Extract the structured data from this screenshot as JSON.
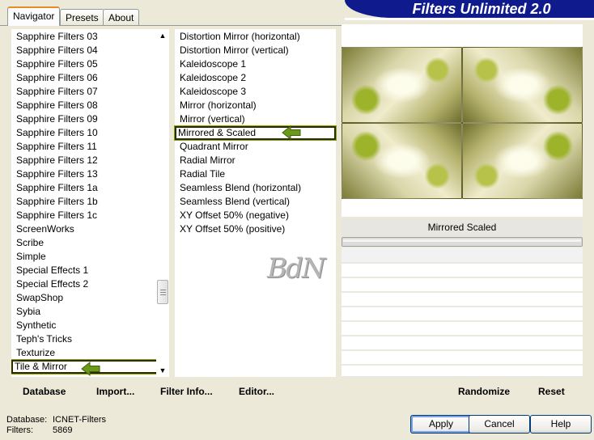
{
  "tabs": [
    "Navigator",
    "Presets",
    "About"
  ],
  "app_title": "Filters Unlimited 2.0",
  "categories": [
    "Sapphire Filters 03",
    "Sapphire Filters 04",
    "Sapphire Filters 05",
    "Sapphire Filters 06",
    "Sapphire Filters 07",
    "Sapphire Filters 08",
    "Sapphire Filters 09",
    "Sapphire Filters 10",
    "Sapphire Filters 11",
    "Sapphire Filters 12",
    "Sapphire Filters 13",
    "Sapphire Filters 1a",
    "Sapphire Filters 1b",
    "Sapphire Filters 1c",
    "ScreenWorks",
    "Scribe",
    "Simple",
    "Special Effects 1",
    "Special Effects 2",
    "SwapShop",
    "Sybia",
    "Synthetic",
    "Teph's Tricks",
    "Texturize",
    "Tile & Mirror"
  ],
  "selected_category": "Tile & Mirror",
  "filters": [
    "Distortion Mirror (horizontal)",
    "Distortion Mirror (vertical)",
    "Kaleidoscope 1",
    "Kaleidoscope 2",
    "Kaleidoscope 3",
    "Mirror (horizontal)",
    "Mirror (vertical)",
    "Mirrored & Scaled",
    "Quadrant Mirror",
    "Radial Mirror",
    "Radial Tile",
    "Seamless Blend (horizontal)",
    "Seamless Blend (vertical)",
    "XY Offset 50% (negative)",
    "XY Offset 50% (positive)"
  ],
  "selected_filter": "Mirrored & Scaled",
  "watermark": "BdN",
  "preview": {
    "filter_title": "Mirrored  Scaled"
  },
  "toolbar_left": {
    "database": "Database",
    "import": "Import...",
    "filter_info": "Filter Info...",
    "editor": "Editor..."
  },
  "toolbar_right": {
    "randomize": "Randomize",
    "reset": "Reset"
  },
  "status": {
    "database_label": "Database:",
    "database_value": "ICNET-Filters",
    "filters_label": "Filters:",
    "filters_value": "5869"
  },
  "buttons": {
    "apply": "Apply",
    "cancel": "Cancel",
    "help": "Help"
  },
  "colors": {
    "banner": "#0f1a8c",
    "arrow": "#6b9a1a",
    "highlight_border": "#2b2b00"
  }
}
